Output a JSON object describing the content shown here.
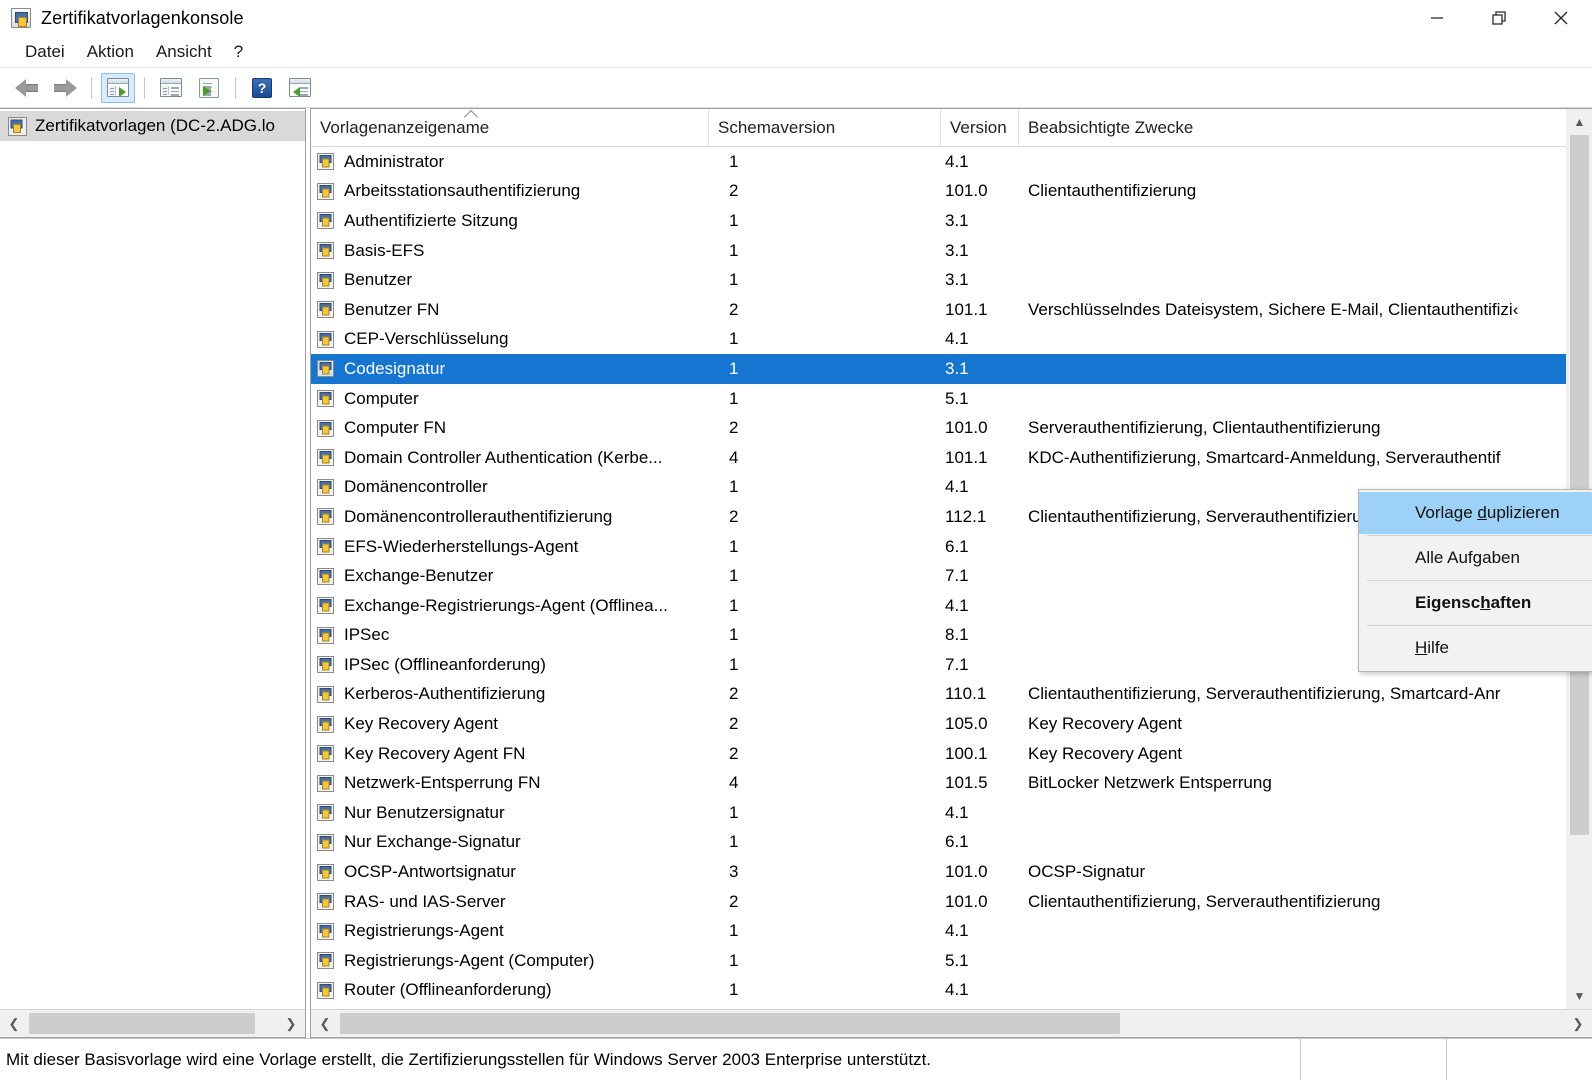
{
  "window": {
    "title": "Zertifikatvorlagenkonsole",
    "icon": "mmc-console-icon",
    "controls": {
      "minimize": "minimize-button",
      "restore": "restore-button",
      "close": "close-button"
    }
  },
  "menubar": {
    "items": [
      {
        "label": "Datei",
        "name": "menu-datei"
      },
      {
        "label": "Aktion",
        "name": "menu-aktion"
      },
      {
        "label": "Ansicht",
        "name": "menu-ansicht"
      },
      {
        "label": "?",
        "name": "menu-hilfe"
      }
    ]
  },
  "toolbar": {
    "buttons": [
      {
        "name": "back-button",
        "icon": "arrow-left-icon"
      },
      {
        "name": "forward-button",
        "icon": "arrow-right-icon"
      },
      {
        "name": "show-hide-tree-button",
        "icon": "console-tree-icon",
        "active": true
      },
      {
        "name": "properties-button",
        "icon": "properties-window-icon"
      },
      {
        "name": "export-list-button",
        "icon": "export-document-icon"
      },
      {
        "name": "help-button",
        "icon": "help-question-icon"
      },
      {
        "name": "show-action-pane-button",
        "icon": "action-pane-icon"
      }
    ]
  },
  "tree": {
    "root": {
      "label": "Zertifikatvorlagen (DC-2.ADG.lo",
      "icon": "certificate-templates-icon"
    },
    "hscroll": {
      "left": "scroll-left-icon",
      "right": "scroll-right-icon"
    }
  },
  "list": {
    "columns": [
      {
        "label": "Vorlagenanzeigename",
        "name": "column-header-template-display-name",
        "sorted": "ascending"
      },
      {
        "label": "Schemaversion",
        "name": "column-header-schema-version"
      },
      {
        "label": "Version",
        "name": "column-header-version"
      },
      {
        "label": "Beabsichtigte Zwecke",
        "name": "column-header-intended-purposes"
      }
    ],
    "rows": [
      {
        "name": "Administrator",
        "schema": "1",
        "version": "4.1",
        "purposes": "",
        "selected": false
      },
      {
        "name": "Arbeitsstationsauthentifizierung",
        "schema": "2",
        "version": "101.0",
        "purposes": "Clientauthentifizierung",
        "selected": false
      },
      {
        "name": "Authentifizierte Sitzung",
        "schema": "1",
        "version": "3.1",
        "purposes": "",
        "selected": false
      },
      {
        "name": "Basis-EFS",
        "schema": "1",
        "version": "3.1",
        "purposes": "",
        "selected": false
      },
      {
        "name": "Benutzer",
        "schema": "1",
        "version": "3.1",
        "purposes": "",
        "selected": false
      },
      {
        "name": "Benutzer FN",
        "schema": "2",
        "version": "101.1",
        "purposes": "Verschlüsselndes Dateisystem, Sichere E-Mail, Clientauthentifizi‹",
        "selected": false
      },
      {
        "name": "CEP-Verschlüsselung",
        "schema": "1",
        "version": "4.1",
        "purposes": "",
        "selected": false
      },
      {
        "name": "Codesignatur",
        "schema": "1",
        "version": "3.1",
        "purposes": "",
        "selected": true
      },
      {
        "name": "Computer",
        "schema": "1",
        "version": "5.1",
        "purposes": "",
        "selected": false
      },
      {
        "name": "Computer FN",
        "schema": "2",
        "version": "101.0",
        "purposes": "Serverauthentifizierung, Clientauthentifizierung",
        "selected": false
      },
      {
        "name": "Domain Controller Authentication (Kerbe...",
        "schema": "4",
        "version": "101.1",
        "purposes": "KDC-Authentifizierung, Smartcard-Anmeldung, Serverauthentif",
        "selected": false
      },
      {
        "name": "Domänencontroller",
        "schema": "1",
        "version": "4.1",
        "purposes": "",
        "selected": false
      },
      {
        "name": "Domänencontrollerauthentifizierung",
        "schema": "2",
        "version": "112.1",
        "purposes": "Clientauthentifizierung, Serverauthentifizierung, Smartcard-Anr",
        "selected": false
      },
      {
        "name": "EFS-Wiederherstellungs-Agent",
        "schema": "1",
        "version": "6.1",
        "purposes": "",
        "selected": false
      },
      {
        "name": "Exchange-Benutzer",
        "schema": "1",
        "version": "7.1",
        "purposes": "",
        "selected": false
      },
      {
        "name": "Exchange-Registrierungs-Agent (Offlinea...",
        "schema": "1",
        "version": "4.1",
        "purposes": "",
        "selected": false
      },
      {
        "name": "IPSec",
        "schema": "1",
        "version": "8.1",
        "purposes": "",
        "selected": false
      },
      {
        "name": "IPSec (Offlineanforderung)",
        "schema": "1",
        "version": "7.1",
        "purposes": "",
        "selected": false
      },
      {
        "name": "Kerberos-Authentifizierung",
        "schema": "2",
        "version": "110.1",
        "purposes": "Clientauthentifizierung, Serverauthentifizierung, Smartcard-Anr",
        "selected": false
      },
      {
        "name": "Key Recovery Agent",
        "schema": "2",
        "version": "105.0",
        "purposes": "Key Recovery Agent",
        "selected": false
      },
      {
        "name": "Key Recovery Agent FN",
        "schema": "2",
        "version": "100.1",
        "purposes": "Key Recovery Agent",
        "selected": false
      },
      {
        "name": "Netzwerk-Entsperrung FN",
        "schema": "4",
        "version": "101.5",
        "purposes": "BitLocker Netzwerk Entsperrung",
        "selected": false
      },
      {
        "name": "Nur Benutzersignatur",
        "schema": "1",
        "version": "4.1",
        "purposes": "",
        "selected": false
      },
      {
        "name": "Nur Exchange-Signatur",
        "schema": "1",
        "version": "6.1",
        "purposes": "",
        "selected": false
      },
      {
        "name": "OCSP-Antwortsignatur",
        "schema": "3",
        "version": "101.0",
        "purposes": "OCSP-Signatur",
        "selected": false
      },
      {
        "name": "RAS- und IAS-Server",
        "schema": "2",
        "version": "101.0",
        "purposes": "Clientauthentifizierung, Serverauthentifizierung",
        "selected": false
      },
      {
        "name": "Registrierungs-Agent",
        "schema": "1",
        "version": "4.1",
        "purposes": "",
        "selected": false
      },
      {
        "name": "Registrierungs-Agent (Computer)",
        "schema": "1",
        "version": "5.1",
        "purposes": "",
        "selected": false
      },
      {
        "name": "Router (Offlineanforderung)",
        "schema": "1",
        "version": "4.1",
        "purposes": "",
        "selected": false
      }
    ]
  },
  "contextmenu": {
    "items": [
      {
        "label": "Vorlage duplizieren",
        "name": "ctx-duplicate-template",
        "highlight": true,
        "accel_index": 8
      },
      {
        "label": "Alle Aufgaben",
        "name": "ctx-all-tasks",
        "submenu": true,
        "accel_index": 8
      },
      {
        "label": "Eigenschaften",
        "name": "ctx-properties",
        "bold": true,
        "accel_index": 7
      },
      {
        "label": "Hilfe",
        "name": "ctx-help",
        "accel_index": 0
      }
    ]
  },
  "statusbar": {
    "text": "Mit dieser Basisvorlage wird eine Vorlage erstellt, die Zertifizierungsstellen für Windows Server 2003 Enterprise unterstützt."
  },
  "colors": {
    "selection": "#1575d1",
    "menu_highlight": "#9ed1f7",
    "toolbar_active": "#d6ebfb",
    "tree_node": "#d9d9d9",
    "scrollbar_thumb": "#cdcdcd"
  }
}
